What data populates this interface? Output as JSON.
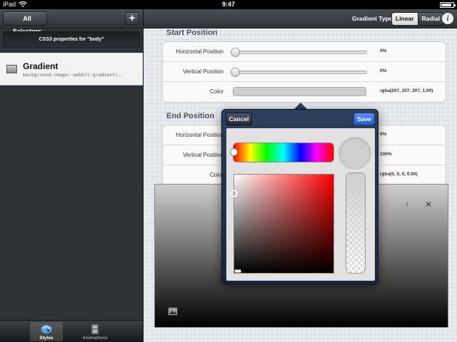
{
  "status_bar": {
    "carrier": "iPad",
    "time": "9:47",
    "battery_level": 0.9
  },
  "left_pane": {
    "all_selectors_label": "All Selectors",
    "add_label": "+",
    "section_title": "CSS3 properties for \"body\"",
    "item": {
      "title": "Gradient",
      "subtitle": "background-image:-webkit-gradient(…"
    },
    "tabs": [
      {
        "label": "Styles",
        "icon": "palette-icon",
        "active": true
      },
      {
        "label": "Animations",
        "icon": "film-icon",
        "active": false
      }
    ]
  },
  "toolbar": {
    "gradient_type_label": "Gradient Type",
    "options": [
      "Linear",
      "Radial"
    ],
    "selected": "Linear",
    "info_label": "i"
  },
  "start_position": {
    "title": "Start Position",
    "rows": [
      {
        "label": "Horizontal Position",
        "value": "0%",
        "slider_value": 0
      },
      {
        "label": "Vertical Position",
        "value": "0%",
        "slider_value": 0
      },
      {
        "label": "Color",
        "value": "rgba(207, 207, 207, 1.00)",
        "color": "#cfcfcf"
      }
    ]
  },
  "end_position": {
    "title": "End Position",
    "rows": [
      {
        "label": "Horizontal Position",
        "value": "0%"
      },
      {
        "label": "Vertical Position",
        "value": "100%"
      },
      {
        "label": "Color",
        "value": "rgba(0, 0, 0, 0.00)"
      }
    ]
  },
  "color_picker": {
    "cancel_label": "Cancel",
    "save_label": "Save",
    "selected_color": "#cfcfcf",
    "hue_color": "#ff0000"
  },
  "preview": {
    "move_up_icon": "arrow-up-icon",
    "close_icon": "close-icon",
    "image_icon": "image-icon",
    "gradient_from": "#cfcfcf",
    "gradient_to": "#000000"
  }
}
